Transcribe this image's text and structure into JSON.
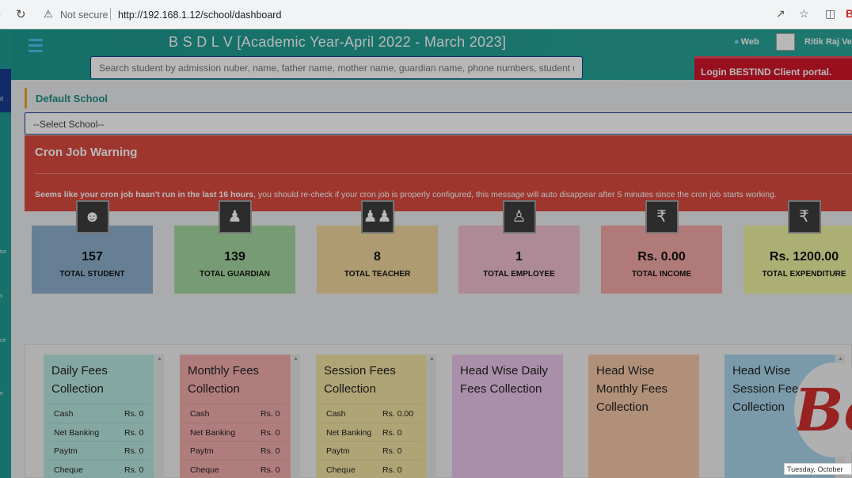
{
  "browser": {
    "back_icon": "back-arrow-icon",
    "reload_icon": "reload-icon",
    "not_secure": "Not secure",
    "url": "http://192.168.1.12/school/dashboard",
    "icons": [
      "share-icon",
      "star-icon",
      "sidebar-icon"
    ]
  },
  "sidebar": {
    "fragments": [
      "d",
      "tor",
      "s",
      "ce",
      "e"
    ]
  },
  "header": {
    "title": "B S D L V [Academic Year-April 2022 - March 2023]",
    "web_label": "Web",
    "user_name": "Ritik Raj Ver",
    "search_placeholder": "Search student by admission nuber, name, father name, mother name, guardian name, phone numbers, student unique",
    "login_button": "Login BESTIND Client portal."
  },
  "school": {
    "label": "Default School",
    "select_value": "--Select School--"
  },
  "cron": {
    "title": "Cron Job Warning",
    "message_bold": "Seems like your cron job hasn't run in the last 16 hours",
    "message_rest": ", you should re-check if your cron job is properly configured, this message will auto disappear after 5 minutes since the cron job starts working."
  },
  "stats": [
    {
      "value": "157",
      "label": "TOTAL STUDENT",
      "icon": "student-icon",
      "color": "#8fb1cf"
    },
    {
      "value": "139",
      "label": "TOTAL GUARDIAN",
      "icon": "guardian-icon",
      "color": "#a6d9a3"
    },
    {
      "value": "8",
      "label": "TOTAL TEACHER",
      "icon": "teacher-group-icon",
      "color": "#f1d79f"
    },
    {
      "value": "1",
      "label": "TOTAL EMPLOYEE",
      "icon": "employee-icon",
      "color": "#f2c0d0"
    },
    {
      "value": "Rs. 0.00",
      "label": "TOTAL INCOME",
      "icon": "rupee-icon",
      "color": "#f4a9a8"
    },
    {
      "value": "Rs. 1200.00",
      "label": "TOTAL EXPENDITURE",
      "icon": "rupee-icon",
      "color": "#eef3a0"
    }
  ],
  "fee_cards": [
    {
      "title": "Daily Fees Collection",
      "color": "#b9e8e0",
      "rows": [
        {
          "method": "Cash",
          "value": "Rs. 0"
        },
        {
          "method": "Net Banking",
          "value": "Rs. 0"
        },
        {
          "method": "Paytm",
          "value": "Rs. 0"
        },
        {
          "method": "Cheque",
          "value": "Rs. 0"
        }
      ]
    },
    {
      "title": "Monthly Fees Collection",
      "color": "#f4adad",
      "rows": [
        {
          "method": "Cash",
          "value": "Rs. 0"
        },
        {
          "method": "Net Banking",
          "value": "Rs. 0"
        },
        {
          "method": "Paytm",
          "value": "Rs. 0"
        },
        {
          "method": "Cheque",
          "value": "Rs. 0"
        }
      ]
    },
    {
      "title": "Session Fees Collection",
      "color": "#f3e3a3",
      "rows": [
        {
          "method": "Cash",
          "value": "Rs. 0.00"
        },
        {
          "method": "Net Banking",
          "value": "Rs. 0"
        },
        {
          "method": "Paytm",
          "value": "Rs. 0"
        },
        {
          "method": "Cheque",
          "value": "Rs. 0"
        }
      ]
    },
    {
      "title": "Head Wise Daily Fees Collection",
      "color": "#ebc7eb",
      "rows": []
    },
    {
      "title": "Head Wise Monthly Fees Collection",
      "color": "#f6c8a8",
      "rows": []
    },
    {
      "title": "Head Wise Session Fees Collection",
      "color": "#a9d6ec",
      "rows": []
    }
  ],
  "logo_text": "Be",
  "taskbar_date": "Tuesday, October"
}
